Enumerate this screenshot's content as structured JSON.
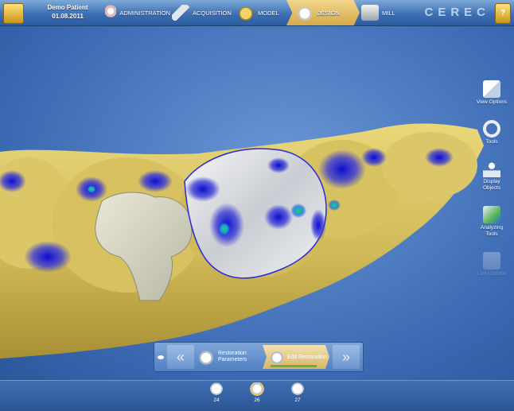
{
  "patient": {
    "name": "Demo Patient",
    "date": "01.08.2011"
  },
  "steps": [
    {
      "label": "ADMINISTRATION",
      "icon": "jaw-icon",
      "active": false
    },
    {
      "label": "ACQUISITION",
      "icon": "camera-icon",
      "active": false
    },
    {
      "label": "MODEL",
      "icon": "model-tooth-icon",
      "active": false
    },
    {
      "label": "DESIGN",
      "icon": "design-tooth-icon",
      "active": true
    },
    {
      "label": "MILL",
      "icon": "mill-machine-icon",
      "active": false
    }
  ],
  "brand": "CEREC",
  "brand_icon_glyph": "?",
  "side_tools": [
    {
      "label": "View Options",
      "icon": "view-cube-icon",
      "enabled": true
    },
    {
      "label": "Tools",
      "icon": "tools-ring-icon",
      "enabled": true
    },
    {
      "label": "Display Objects",
      "icon": "display-objects-icon",
      "enabled": true
    },
    {
      "label": "Analyzing Tools",
      "icon": "analyzing-tools-icon",
      "enabled": true
    },
    {
      "label": "Link Options",
      "icon": "link-options-icon",
      "enabled": false
    }
  ],
  "workflow": {
    "prev_label": "«",
    "next_label": "»",
    "steps": [
      {
        "label": "Restoration Parameters",
        "active": false
      },
      {
        "label": "Edit Restoration",
        "active": true
      }
    ]
  },
  "teeth": [
    {
      "number": "24",
      "active": false
    },
    {
      "number": "26",
      "active": true
    },
    {
      "number": "27",
      "active": false
    }
  ],
  "colors": {
    "accent": "#e8c45a",
    "background": "#3a69b2",
    "model": "#d9c466",
    "restoration": "#e4e6ea",
    "heatmap": "#1a1acd"
  }
}
